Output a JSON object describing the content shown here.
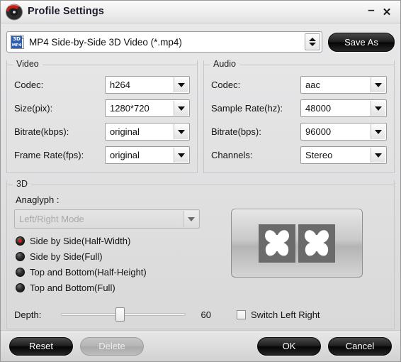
{
  "window": {
    "title": "Profile Settings",
    "app_icon": "disc-logo-icon",
    "minimize_label": "–",
    "close_label": "✕"
  },
  "profile": {
    "format_icon": "mp4-3d-file-icon",
    "icon_badge_top": "3D",
    "icon_badge_bottom": "MP4",
    "selected": "MP4 Side-by-Side 3D Video (*.mp4)",
    "spinner_icon": "up-down-spinner-icon",
    "save_as_label": "Save As"
  },
  "video": {
    "title": "Video",
    "fields": [
      {
        "label": "Codec:",
        "value": "h264"
      },
      {
        "label": "Size(pix):",
        "value": "1280*720"
      },
      {
        "label": "Bitrate(kbps):",
        "value": "original"
      },
      {
        "label": "Frame Rate(fps):",
        "value": "original"
      }
    ]
  },
  "audio": {
    "title": "Audio",
    "fields": [
      {
        "label": "Codec:",
        "value": "aac"
      },
      {
        "label": "Sample Rate(hz):",
        "value": "48000"
      },
      {
        "label": "Bitrate(bps):",
        "value": "96000"
      },
      {
        "label": "Channels:",
        "value": "Stereo"
      }
    ]
  },
  "threed": {
    "title": "3D",
    "anaglyph_label": "Anaglyph :",
    "anaglyph_value": "Left/Right Mode",
    "modes": [
      {
        "label": "Side by Side(Half-Width)",
        "selected": true
      },
      {
        "label": "Side by Side(Full)",
        "selected": false
      },
      {
        "label": "Top and Bottom(Half-Height)",
        "selected": false
      },
      {
        "label": "Top and Bottom(Full)",
        "selected": false
      }
    ],
    "preview_icon": "side-by-side-butterfly-preview",
    "depth_label": "Depth:",
    "depth_value": "60",
    "depth_percent": 47,
    "switch_label": "Switch Left Right",
    "switch_checked": false
  },
  "footer": {
    "reset_label": "Reset",
    "delete_label": "Delete",
    "ok_label": "OK",
    "cancel_label": "Cancel"
  },
  "colors": {
    "accent_red": "#e01a10",
    "badge_blue": "#2b5fb4",
    "window_bg": "#e0e0e1",
    "button_black": "#0a0a0a"
  }
}
